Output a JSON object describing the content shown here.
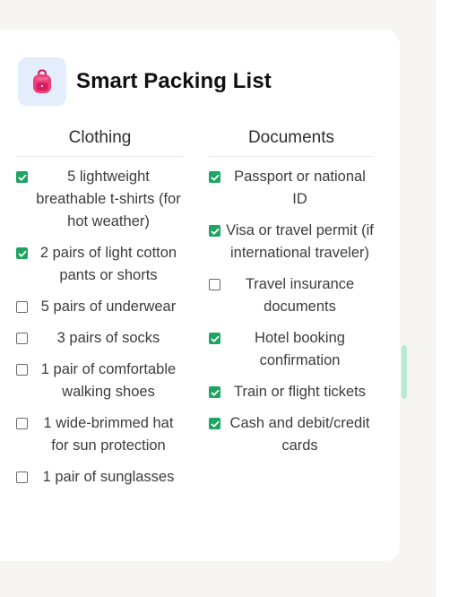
{
  "app": {
    "title": "Smart Packing List",
    "icon": "backpack-icon",
    "accent": "#1fa463",
    "icon_tile_bg": "#e3edfb"
  },
  "columns": [
    {
      "title": "Clothing",
      "items": [
        {
          "label": "5 lightweight breathable t-shirts (for hot weather)",
          "checked": true
        },
        {
          "label": "2 pairs of light cotton pants or shorts",
          "checked": true
        },
        {
          "label": "5 pairs of underwear",
          "checked": false
        },
        {
          "label": "3 pairs of socks",
          "checked": false
        },
        {
          "label": "1 pair of comfortable walking shoes",
          "checked": false
        },
        {
          "label": "1 wide-brimmed hat for sun protection",
          "checked": false
        },
        {
          "label": "1 pair of sunglasses",
          "checked": false
        }
      ]
    },
    {
      "title": "Documents",
      "items": [
        {
          "label": "Passport or national ID",
          "checked": true
        },
        {
          "label": "Visa or travel permit (if international traveler)",
          "checked": true
        },
        {
          "label": "Travel insurance documents",
          "checked": false
        },
        {
          "label": "Hotel booking confirmation",
          "checked": true
        },
        {
          "label": "Train or flight tickets",
          "checked": true
        },
        {
          "label": "Cash and debit/credit cards",
          "checked": true
        }
      ]
    }
  ]
}
